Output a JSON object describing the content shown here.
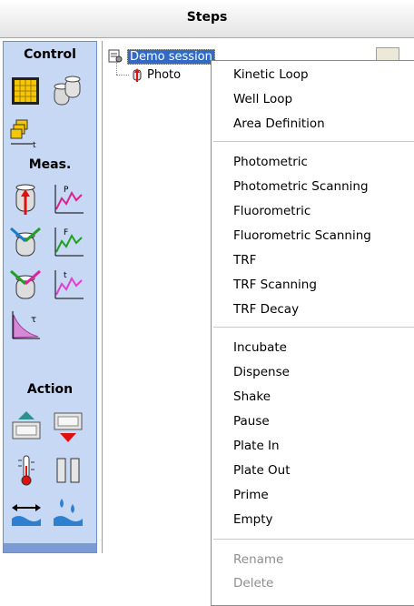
{
  "header": {
    "title": "Steps"
  },
  "toolbox": {
    "sections": [
      {
        "label": "Control",
        "tools": [
          "plate-grid-icon",
          "wells-icon",
          "kinetic-loop-icon"
        ]
      },
      {
        "label": "Meas.",
        "tools": [
          "photometric-icon",
          "photometric-scan-icon",
          "fluorometric-icon",
          "fluorometric-scan-icon",
          "trf-icon",
          "trf-scan-icon",
          "trf-decay-icon"
        ]
      },
      {
        "label": "Action",
        "tools": [
          "plate-in-icon",
          "plate-out-icon",
          "thermometer-icon",
          "pause-icon",
          "shake-icon",
          "dispense-icon"
        ]
      }
    ],
    "decay_icon_letter": "τ",
    "kinetic_icon_letter": "t",
    "photometric_scan_letter": "P",
    "fluorometric_scan_letter": "F",
    "trf_scan_letter": "t"
  },
  "tree": {
    "root_label": "Demo session",
    "child_label": "Photo"
  },
  "context_menu": {
    "group1": [
      "Kinetic Loop",
      "Well Loop",
      "Area Definition"
    ],
    "group2": [
      "Photometric",
      "Photometric Scanning",
      "Fluorometric",
      "Fluorometric Scanning",
      "TRF",
      "TRF Scanning",
      "TRF Decay"
    ],
    "group3": [
      "Incubate",
      "Dispense",
      "Shake",
      "Pause",
      "Plate In",
      "Plate Out",
      "Prime",
      "Empty"
    ],
    "group4": [
      "Rename",
      "Delete"
    ]
  },
  "colors": {
    "selection": "#316ac5",
    "toolbox_bg": "#c7d8f4",
    "disabled_text": "#8d8d8d"
  }
}
